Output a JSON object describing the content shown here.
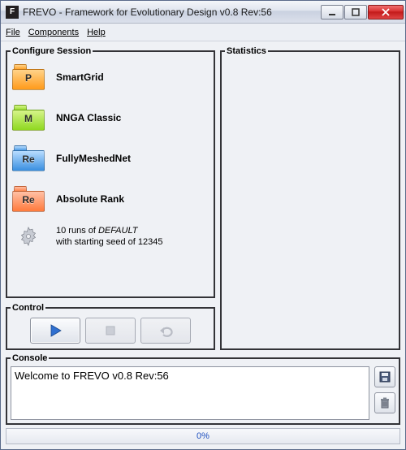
{
  "window": {
    "title": "FREVO - Framework for Evolutionary Design v0.8 Rev:56",
    "app_letter": "F"
  },
  "menu": {
    "file": "File",
    "components": "Components",
    "help": "Help"
  },
  "panels": {
    "configure_title": "Configure Session",
    "control_title": "Control",
    "statistics_title": "Statistics",
    "console_title": "Console"
  },
  "session": {
    "items": [
      {
        "label": "SmartGrid",
        "letter": "P",
        "color": "orange"
      },
      {
        "label": "NNGA Classic",
        "letter": "M",
        "color": "green"
      },
      {
        "label": "FullyMeshedNet",
        "letter": "Re",
        "color": "blue"
      },
      {
        "label": "Absolute Rank",
        "letter": "Re",
        "color": "red"
      }
    ],
    "runs_prefix": "10 runs of ",
    "runs_default": "DEFAULT",
    "runs_seed": "with starting seed of 12345"
  },
  "console": {
    "message": "Welcome to FREVO v0.8 Rev:56"
  },
  "progress": {
    "text": "0%"
  }
}
